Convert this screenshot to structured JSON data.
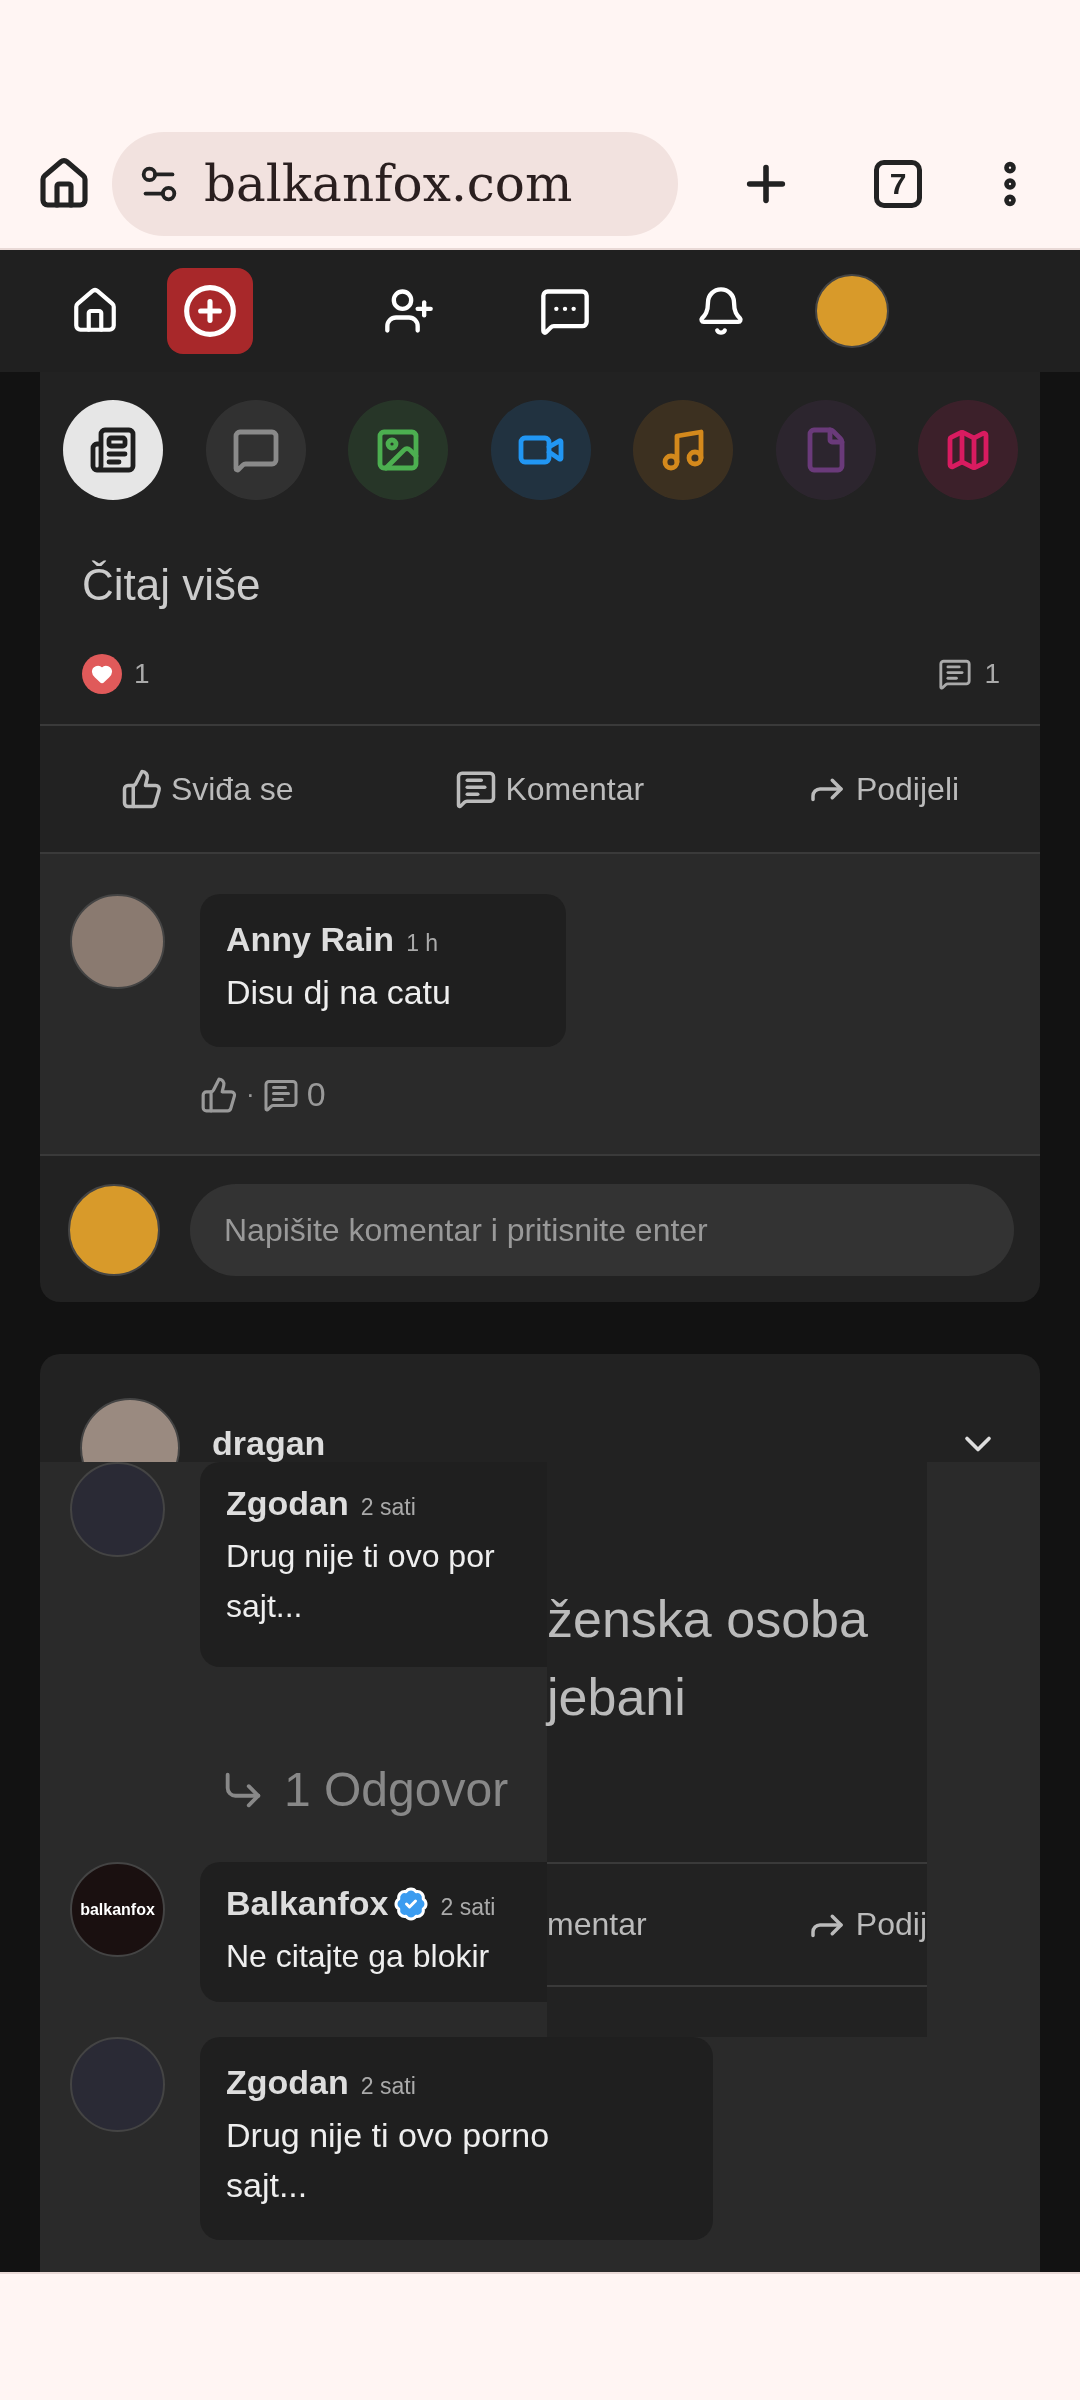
{
  "browser": {
    "url": "balkanfox.com",
    "tab_count": "7"
  },
  "categories": [
    {
      "kind": "article",
      "color": "#1f1f1f",
      "selected": true
    },
    {
      "kind": "text",
      "color": "#8a8a8a",
      "selected": false
    },
    {
      "kind": "image",
      "color": "#4caf50",
      "selected": false
    },
    {
      "kind": "video",
      "color": "#2196f3",
      "selected": false
    },
    {
      "kind": "music",
      "color": "#d4891c",
      "selected": false
    },
    {
      "kind": "file",
      "color": "#6a3a7a",
      "selected": false
    },
    {
      "kind": "map",
      "color": "#d81b60",
      "selected": false
    }
  ],
  "post": {
    "title": "Čitaj više",
    "reaction_count": "1",
    "comment_count": "1",
    "actions": [
      "Sviđa se",
      "Komentar",
      "Podijeli"
    ],
    "comments": [
      {
        "author": "Anny Rain",
        "time": "1 h",
        "text": "Disu dj na catu",
        "separator": "·",
        "reply_count": "0"
      }
    ],
    "comment_placeholder": "Napišite komentar i pritisnite enter"
  },
  "post2": {
    "author": "dragan",
    "comments": [
      {
        "author": "Zgodan",
        "verified": false,
        "time": "2 sati",
        "text": "Drug nije ti ovo por\nsajt..."
      },
      {
        "author": "Balkanfox",
        "verified": true,
        "time": "2 sati",
        "text": "Ne citajte ga blokir",
        "avatar_text": "balkanfox"
      }
    ],
    "replies_link": "1 Odgovor",
    "overlay": {
      "text_lines": [
        "ženska osoba",
        "jebani"
      ],
      "action_1": "mentar",
      "action_2": "Podij"
    },
    "last_comment": {
      "author": "Zgodan",
      "time": "2 sati",
      "text": "Drug nije ti ovo porno\nsajt..."
    }
  }
}
